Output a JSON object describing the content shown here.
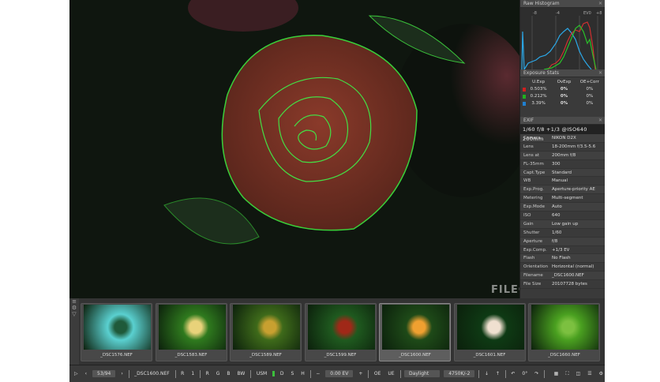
{
  "histogram": {
    "title": "Raw Histogram",
    "scale_labels": [
      "-8",
      "-4",
      "EV0",
      "+8"
    ]
  },
  "exposure_stats": {
    "title": "Exposure Stats",
    "headers": [
      "U.Exp",
      "OvExp",
      "OE+Corr"
    ],
    "rows": [
      {
        "color": "#d02020",
        "u": "0.503%",
        "o": "0%",
        "c": "0%"
      },
      {
        "color": "#20b020",
        "u": "0.212%",
        "o": "0%",
        "c": "0%"
      },
      {
        "color": "#2080d0",
        "u": "3.39%",
        "o": "0%",
        "c": "0%"
      }
    ]
  },
  "exif": {
    "title": "EXIF",
    "summary": "1/60 f/8 +1/3 @ISO640 200mm",
    "rows": [
      [
        "Camera",
        "NIKON D2X"
      ],
      [
        "Lens",
        "18-200mm f/3.5-5.6"
      ],
      [
        "Lens at",
        "200mm f/8"
      ],
      [
        "FL-35mm",
        "300"
      ],
      [
        "Capt.Type",
        "Standard"
      ],
      [
        "WB",
        "Manual"
      ],
      [
        "Exp.Prog.",
        "Aperture-priority AE"
      ],
      [
        "Metering",
        "Multi-segment"
      ],
      [
        "Exp.Mode",
        "Auto"
      ],
      [
        "ISO",
        "640"
      ],
      [
        "Gain",
        "Low gain up"
      ],
      [
        "Shutter",
        "1/60"
      ],
      [
        "Aperture",
        "f/8"
      ],
      [
        "Exp.Comp.",
        "+1/3 EV"
      ],
      [
        "Flash",
        "No Flash"
      ],
      [
        "Orientation",
        "Horizontal (normal)"
      ],
      [
        "Filename",
        "_DSC1600.NEF"
      ],
      [
        "File Size",
        "20107728 bytes"
      ]
    ]
  },
  "filmstrip": [
    {
      "name": "_DSC1576.NEF",
      "c1": "#5ad0d0",
      "c2": "#1f5a3a"
    },
    {
      "name": "_DSC1583.NEF",
      "c1": "#2f7a1e",
      "c2": "#e8d27a"
    },
    {
      "name": "_DSC1589.NEF",
      "c1": "#3e6a1a",
      "c2": "#c8a030"
    },
    {
      "name": "_DSC1599.NEF",
      "c1": "#1f5a1f",
      "c2": "#a02818"
    },
    {
      "name": "_DSC1600.NEF",
      "c1": "#1e4a18",
      "c2": "#f0a030"
    },
    {
      "name": "_DSC1601.NEF",
      "c1": "#0e3a14",
      "c2": "#f0e0d0"
    },
    {
      "name": "_DSC1660.NEF",
      "c1": "#4aa020",
      "c2": "#7cc040"
    }
  ],
  "toolbar": {
    "counter": "53/94",
    "filename": "_DSC1600.NEF",
    "channels": [
      "R",
      "1",
      "R",
      "G",
      "B",
      "BW"
    ],
    "modes": [
      "USM",
      "D",
      "S",
      "H"
    ],
    "ev": "0.00 EV",
    "oe": "OE",
    "ue": "UE",
    "wb": "Daylight",
    "temp": "4750K/-2",
    "rot": "0°"
  },
  "watermark": "FILECR"
}
